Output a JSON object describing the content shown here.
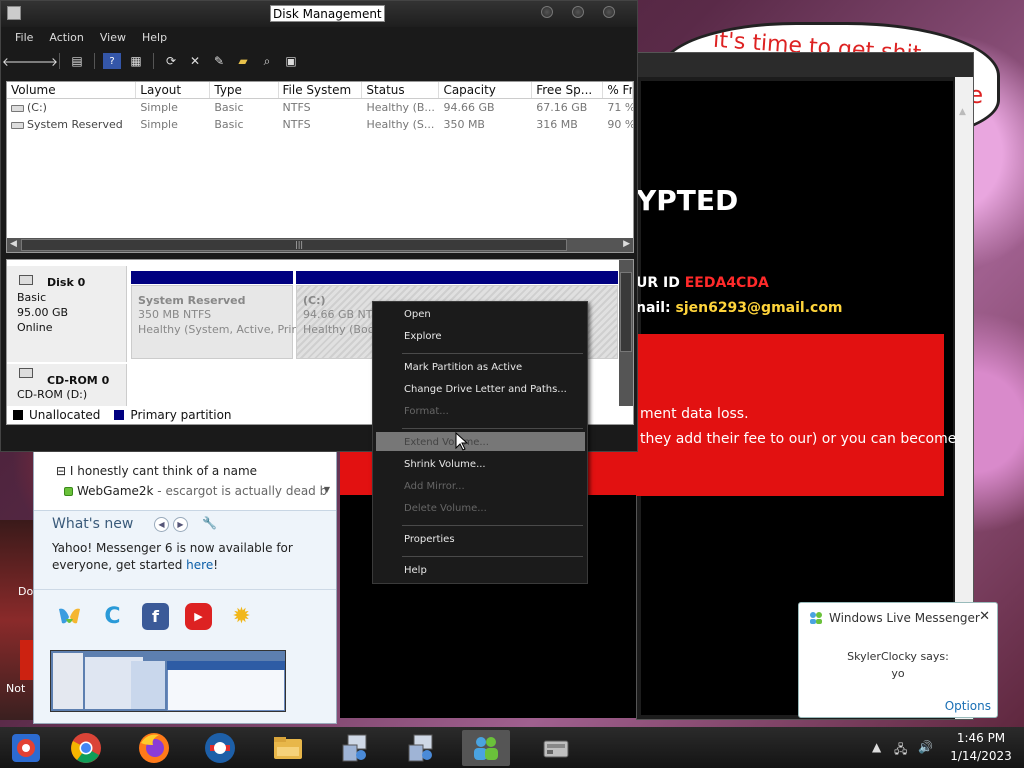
{
  "disk_management": {
    "title": "Disk Management",
    "menu": [
      "File",
      "Action",
      "View",
      "Help"
    ],
    "toolbar_icons": [
      "back-icon",
      "forward-icon",
      "show-hide-tree-icon",
      "help-icon",
      "properties-icon",
      "refresh-icon",
      "delete-icon",
      "rescan-icon",
      "open-icon",
      "explore-icon",
      "settings-icon"
    ],
    "columns": [
      "Volume",
      "Layout",
      "Type",
      "File System",
      "Status",
      "Capacity",
      "Free Sp...",
      "% Fr"
    ],
    "rows": [
      [
        "(C:)",
        "Simple",
        "Basic",
        "NTFS",
        "Healthy (B...",
        "94.66 GB",
        "67.16 GB",
        "71 %"
      ],
      [
        "System Reserved",
        "Simple",
        "Basic",
        "NTFS",
        "Healthy (S...",
        "350 MB",
        "316 MB",
        "90 %"
      ]
    ],
    "disks": {
      "disk0": {
        "name": "Disk 0",
        "kind": "Basic",
        "size": "95.00 GB",
        "state": "Online"
      },
      "cdrom": {
        "name": "CD-ROM 0",
        "desc": "CD-ROM (D:)"
      }
    },
    "partitions": [
      {
        "name": "System Reserved",
        "size": "350 MB NTFS",
        "health": "Healthy (System, Active, Prin"
      },
      {
        "name": "(C:)",
        "size": "94.66 GB NTFS",
        "health": "Healthy (Boot,"
      }
    ],
    "legend": [
      "Unallocated",
      "Primary partition"
    ],
    "colors": {
      "primary": "#000080",
      "unallocated": "#000000"
    }
  },
  "context_menu": {
    "items": [
      {
        "label": "Open",
        "enabled": true
      },
      {
        "label": "Explore",
        "enabled": true
      },
      {
        "label": "Mark Partition as Active",
        "enabled": true
      },
      {
        "label": "Change Drive Letter and Paths...",
        "enabled": true
      },
      {
        "label": "Format...",
        "enabled": false
      },
      {
        "label": "Extend Volume...",
        "enabled": false,
        "hovered": true
      },
      {
        "label": "Shrink Volume...",
        "enabled": true
      },
      {
        "label": "Add Mirror...",
        "enabled": false
      },
      {
        "label": "Delete Volume...",
        "enabled": false
      },
      {
        "label": "Properties",
        "enabled": true
      },
      {
        "label": "Help",
        "enabled": true
      }
    ]
  },
  "ransom": {
    "heading": "YPTED",
    "id_label": "UR ID ",
    "id_value": "EEDA4CDA",
    "email_label": "nail: ",
    "email_value": "sjen6293@gmail.com",
    "line1": "ment data loss.",
    "line2": "they add their fee to our) or you can become",
    "colors": {
      "red": "#e21111",
      "id": "#ff2a2a",
      "email": "#ffd43b"
    }
  },
  "speech_bubble": {
    "text": "it's time to get shit",
    "fragment": "te"
  },
  "yahoo": {
    "contacts": [
      {
        "name": "I honestly cant think of a name"
      },
      {
        "name": "WebGame2k",
        "status": " - escargot is actually dead b"
      }
    ],
    "whats_new_title": "What's new",
    "whats_new_text": "Yahoo! Messenger 6 is now available for everyone, get started ",
    "whats_new_link": "here",
    "whats_new_end": "!",
    "icons": [
      "msn-butterfly-icon",
      "chrome-c-icon",
      "facebook-icon",
      "youtube-icon",
      "sun-icon"
    ]
  },
  "left_partial": {
    "d": "Do",
    "n": "Not"
  },
  "wlm_toast": {
    "title": "Windows Live Messenger",
    "sender": "SkylerClocky says:",
    "message": "yo",
    "options": "Options"
  },
  "taskbar": {
    "apps": [
      "chrome-app-icon",
      "chrome-icon",
      "firefox-icon",
      "edge-icon",
      "file-explorer-icon",
      "network-setup-icon",
      "network-setup-icon-2",
      "messenger-icon",
      "disk-management-icon"
    ],
    "time": "1:46 PM",
    "date": "1/14/2023"
  }
}
